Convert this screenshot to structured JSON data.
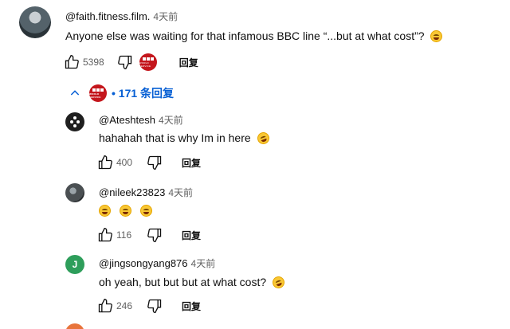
{
  "main_comment": {
    "author": "@faith.fitness.film.",
    "time": "4天前",
    "text": "Anyone else was waiting for that infamous BBC line “...but at what cost”?",
    "likes": "5398",
    "reply_label": "回复",
    "emoji": "grinning-sweat-emoji"
  },
  "replies_toggle": {
    "label": "• 171 条回复"
  },
  "replies": [
    {
      "author": "@Ateshtesh",
      "time": "4天前",
      "text": "hahahah that is why Im in here",
      "likes": "400",
      "reply_label": "回复"
    },
    {
      "author": "@nileek23823",
      "time": "4天前",
      "text": "",
      "likes": "116",
      "reply_label": "回复"
    },
    {
      "author": "@jingsongyang876",
      "time": "4天前",
      "text": "oh yeah, but but but at what cost?",
      "likes": "246",
      "reply_label": "回复",
      "avatar_letter": "J"
    }
  ],
  "colors": {
    "link_blue": "#065fd4",
    "bbc_red": "#c4161c",
    "avatar_green": "#2e9e5b",
    "secondary_text": "#606060"
  }
}
